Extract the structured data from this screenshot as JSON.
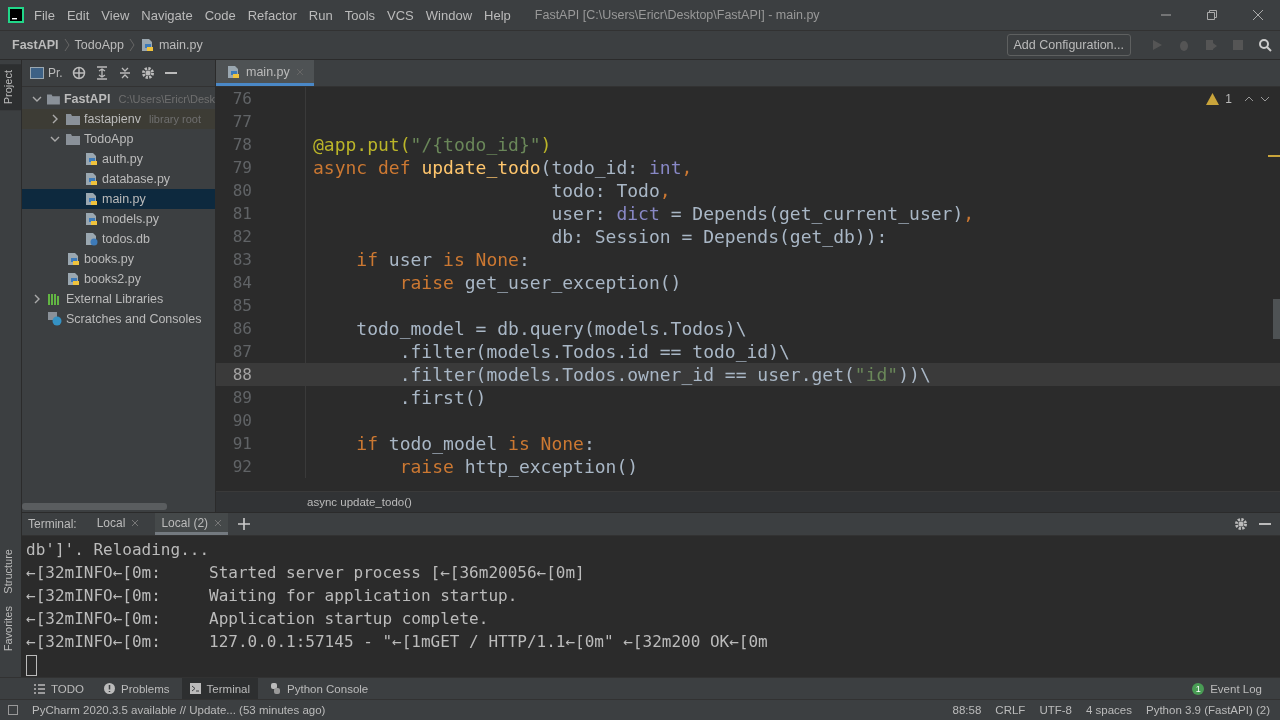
{
  "window": {
    "title": "FastAPI [C:\\Users\\Ericr\\Desktop\\FastAPI] - main.py"
  },
  "menu": [
    "File",
    "Edit",
    "View",
    "Navigate",
    "Code",
    "Refactor",
    "Run",
    "Tools",
    "VCS",
    "Window",
    "Help"
  ],
  "breadcrumbs": [
    "FastAPI",
    "TodoApp",
    "main.py"
  ],
  "run_config": {
    "label": "Add Configuration..."
  },
  "left_strip": [
    {
      "label": "Project",
      "selected": true
    },
    {
      "label": "Structure",
      "selected": false
    },
    {
      "label": "Favorites",
      "selected": false
    }
  ],
  "project": {
    "view_label": "Pr.",
    "tree": [
      {
        "name": "FastAPI",
        "hint": "C:\\Users\\Ericr\\Desk",
        "kind": "folder",
        "expanded": true,
        "selected": false,
        "children": [
          {
            "name": "fastapienv",
            "hint": "library root",
            "kind": "library",
            "expanded": false,
            "selected": false
          },
          {
            "name": "TodoApp",
            "kind": "folder",
            "expanded": true,
            "selected": false,
            "children": [
              {
                "name": "auth.py",
                "kind": "py",
                "selected": false
              },
              {
                "name": "database.py",
                "kind": "py",
                "selected": false
              },
              {
                "name": "main.py",
                "kind": "py",
                "selected": true
              },
              {
                "name": "models.py",
                "kind": "py",
                "selected": false
              },
              {
                "name": "todos.db",
                "kind": "db",
                "selected": false
              }
            ]
          },
          {
            "name": "books.py",
            "kind": "py",
            "selected": false
          },
          {
            "name": "books2.py",
            "kind": "py",
            "selected": false
          }
        ]
      },
      {
        "name": "External Libraries",
        "kind": "libraries",
        "expanded": false,
        "selected": false
      },
      {
        "name": "Scratches and Consoles",
        "kind": "scratches",
        "selected": false
      }
    ]
  },
  "editor": {
    "tabs": [
      {
        "label": "main.py",
        "selected": true
      }
    ],
    "warnings": "1",
    "lines": [
      {
        "number": "76",
        "current": false
      },
      {
        "number": "77",
        "current": false
      },
      {
        "number": "78",
        "current": false,
        "tokens": [
          {
            "kind": "deco",
            "text": "@app.put("
          },
          {
            "kind": "str",
            "text": "\"/{todo_id}\""
          },
          {
            "kind": "deco",
            "text": ")"
          }
        ]
      },
      {
        "number": "79",
        "current": false,
        "tokens": [
          {
            "kind": "kw",
            "text": "async def "
          },
          {
            "kind": "fn",
            "text": "update_todo"
          },
          {
            "kind": "plain",
            "text": "(todo_id: "
          },
          {
            "kind": "builtin",
            "text": "int"
          },
          {
            "kind": "kw",
            "text": ","
          }
        ]
      },
      {
        "number": "80",
        "current": false,
        "tokens": [
          {
            "kind": "plain",
            "text": "                      todo: Todo"
          },
          {
            "kind": "kw",
            "text": ","
          }
        ]
      },
      {
        "number": "81",
        "current": false,
        "tokens": [
          {
            "kind": "plain",
            "text": "                      user: "
          },
          {
            "kind": "builtin",
            "text": "dict"
          },
          {
            "kind": "plain",
            "text": " = Depends(get_current_user)"
          },
          {
            "kind": "kw",
            "text": ","
          }
        ]
      },
      {
        "number": "82",
        "current": false,
        "tokens": [
          {
            "kind": "plain",
            "text": "                      db: Session = Depends(get_db)):"
          }
        ]
      },
      {
        "number": "83",
        "current": false,
        "tokens": [
          {
            "kind": "kw",
            "text": "    if "
          },
          {
            "kind": "plain",
            "text": "user "
          },
          {
            "kind": "kw",
            "text": "is None"
          },
          {
            "kind": "plain",
            "text": ":"
          }
        ]
      },
      {
        "number": "84",
        "current": false,
        "tokens": [
          {
            "kind": "kw",
            "text": "        raise "
          },
          {
            "kind": "plain",
            "text": "get_user_exception()"
          }
        ]
      },
      {
        "number": "85",
        "current": false
      },
      {
        "number": "86",
        "current": false,
        "tokens": [
          {
            "kind": "plain",
            "text": "    todo_model = db.query(models.Todos)\\"
          }
        ]
      },
      {
        "number": "87",
        "current": false,
        "tokens": [
          {
            "kind": "plain",
            "text": "        .filter(models.Todos.id == todo_id)\\"
          }
        ]
      },
      {
        "number": "88",
        "current": true,
        "tokens": [
          {
            "kind": "plain",
            "text": "        .filter(models.Todos.owner_id == user.get("
          },
          {
            "kind": "str",
            "text": "\"id\""
          },
          {
            "kind": "plain",
            "text": "))\\"
          }
        ]
      },
      {
        "number": "89",
        "current": false,
        "tokens": [
          {
            "kind": "plain",
            "text": "        .first()"
          }
        ]
      },
      {
        "number": "90",
        "current": false
      },
      {
        "number": "91",
        "current": false,
        "tokens": [
          {
            "kind": "kw",
            "text": "    if "
          },
          {
            "kind": "plain",
            "text": "todo_model "
          },
          {
            "kind": "kw",
            "text": "is None"
          },
          {
            "kind": "plain",
            "text": ":"
          }
        ]
      },
      {
        "number": "92",
        "current": false,
        "tokens": [
          {
            "kind": "kw",
            "text": "        raise "
          },
          {
            "kind": "plain",
            "text": "http_exception()"
          }
        ]
      }
    ],
    "context": "async update_todo()"
  },
  "terminal": {
    "label": "Terminal:",
    "tabs": [
      {
        "label": "Local",
        "selected": false
      },
      {
        "label": "Local (2)",
        "selected": true
      }
    ],
    "lines": [
      "db']'. Reloading...",
      "←[32mINFO←[0m:     Started server process [←[36m20056←[0m]",
      "←[32mINFO←[0m:     Waiting for application startup.",
      "←[32mINFO←[0m:     Application startup complete.",
      "←[32mINFO←[0m:     127.0.0.1:57145 - \"←[1mGET / HTTP/1.1←[0m\" ←[32m200 OK←[0m"
    ]
  },
  "tool_tabs": [
    {
      "label": "TODO",
      "kind": "todo",
      "selected": false
    },
    {
      "label": "Problems",
      "kind": "problems",
      "selected": false
    },
    {
      "label": "Terminal",
      "kind": "terminal",
      "selected": true
    },
    {
      "label": "Python Console",
      "kind": "console",
      "selected": false
    }
  ],
  "event_log": {
    "label": "Event Log",
    "count": "1"
  },
  "status_bar": {
    "message": "PyCharm 2020.3.5 available // Update... (53 minutes ago)",
    "items": [
      "88:58",
      "CRLF",
      "UTF-8",
      "4 spaces",
      "Python 3.9 (FastAPI) (2)"
    ]
  }
}
